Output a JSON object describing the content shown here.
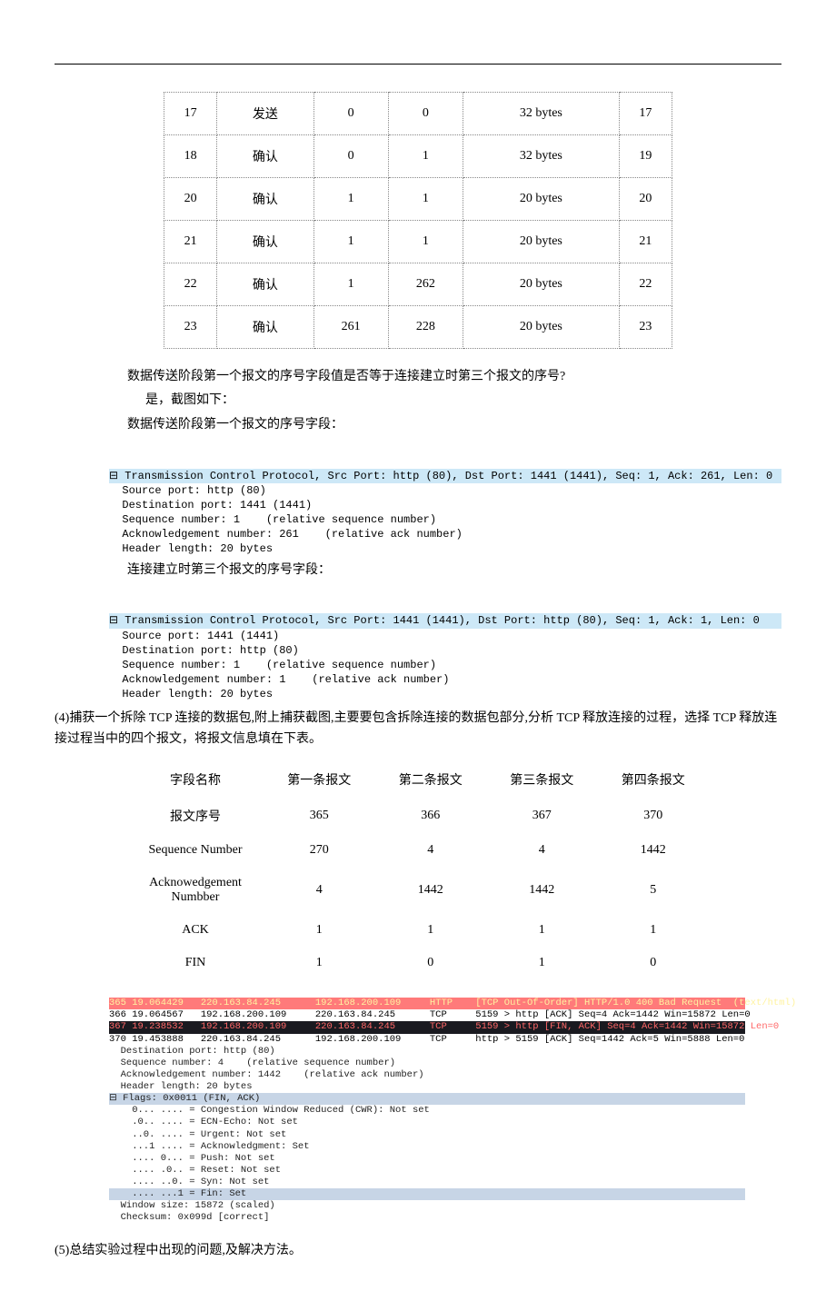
{
  "table1": {
    "rows": [
      [
        "17",
        "发送",
        "0",
        "0",
        "32 bytes",
        "17"
      ],
      [
        "18",
        "确认",
        "0",
        "1",
        "32 bytes",
        "19"
      ],
      [
        "20",
        "确认",
        "1",
        "1",
        "20 bytes",
        "20"
      ],
      [
        "21",
        "确认",
        "1",
        "1",
        "20 bytes",
        "21"
      ],
      [
        "22",
        "确认",
        "1",
        "262",
        "20 bytes",
        "22"
      ],
      [
        "23",
        "确认",
        "261",
        "228",
        "20 bytes",
        "23"
      ]
    ]
  },
  "q_text": "数据传送阶段第一个报文的序号字段值是否等于连接建立时第三个报文的序号?",
  "a_text": "是，截图如下：",
  "cap1": "数据传送阶段第一个报文的序号字段：",
  "code1": [
    "Transmission Control Protocol, Src Port: http (80), Dst Port: 1441 (1441), Seq: 1, Ack: 261, Len: 0",
    "  Source port: http (80)",
    "  Destination port: 1441 (1441)",
    "  Sequence number: 1    (relative sequence number)",
    "  Acknowledgement number: 261    (relative ack number)",
    "  Header length: 20 bytes"
  ],
  "cap2": "连接建立时第三个报文的序号字段：",
  "code2": [
    "Transmission Control Protocol, Src Port: 1441 (1441), Dst Port: http (80), Seq: 1, Ack: 1, Len: 0",
    "  Source port: 1441 (1441)",
    "  Destination port: http (80)",
    "  Sequence number: 1    (relative sequence number)",
    "  Acknowledgement number: 1    (relative ack number)",
    "  Header length: 20 bytes"
  ],
  "q4": "(4)捕获一个拆除 TCP 连接的数据包,附上捕获截图,主要要包含拆除连接的数据包部分,分析 TCP 释放连接的过程，选择 TCP 释放连接过程当中的四个报文，将报文信息填在下表。",
  "table2": {
    "header": [
      "字段名称",
      "第一条报文",
      "第二条报文",
      "第三条报文",
      "第四条报文"
    ],
    "rows": [
      [
        "报文序号",
        "365",
        "366",
        "367",
        "370"
      ],
      [
        "Sequence Number",
        "270",
        "4",
        "4",
        "1442"
      ],
      [
        "Acknowedgement Numbber",
        "4",
        "1442",
        "1442",
        "5"
      ],
      [
        "ACK",
        "1",
        "1",
        "1",
        "1"
      ],
      [
        "FIN",
        "1",
        "0",
        "1",
        "0"
      ]
    ]
  },
  "ws": {
    "rows": [
      {
        "cls": "ws-red",
        "t": "365 19.064429   220.163.84.245      192.168.200.109     HTTP    [TCP Out-Of-Order] HTTP/1.0 400 Bad Request  (text/html)"
      },
      {
        "cls": "ws-white",
        "t": "366 19.064567   192.168.200.109     220.163.84.245      TCP     5159 > http [ACK] Seq=4 Ack=1442 Win=15872 Len=0"
      },
      {
        "cls": "ws-dark",
        "t": "367 19.238532   192.168.200.109     220.163.84.245      TCP     5159 > http [FIN, ACK] Seq=4 Ack=1442 Win=15872 Len=0"
      },
      {
        "cls": "ws-white",
        "t": "370 19.453888   220.163.84.245      192.168.200.109     TCP     http > 5159 [ACK] Seq=1442 Ack=5 Win=5888 Len=0"
      }
    ],
    "body_top": [
      "  Destination port: http (80)",
      "  Sequence number: 4    (relative sequence number)",
      "  Acknowledgement number: 1442    (relative ack number)",
      "  Header length: 20 bytes"
    ],
    "flags_line": "⊟ Flags: 0x0011 (FIN, ACK)",
    "flags": [
      "    0... .... = Congestion Window Reduced (CWR): Not set",
      "    .0.. .... = ECN-Echo: Not set",
      "    ..0. .... = Urgent: Not set",
      "    ...1 .... = Acknowledgment: Set",
      "    .... 0... = Push: Not set",
      "    .... .0.. = Reset: Not set",
      "    .... ..0. = Syn: Not set"
    ],
    "fin_line": "    .... ...1 = Fin: Set",
    "body_bot": [
      "  Window size: 15872 (scaled)",
      "  Checksum: 0x099d [correct]"
    ]
  },
  "q5": "(5)总结实验过程中出现的问题,及解决方法。"
}
